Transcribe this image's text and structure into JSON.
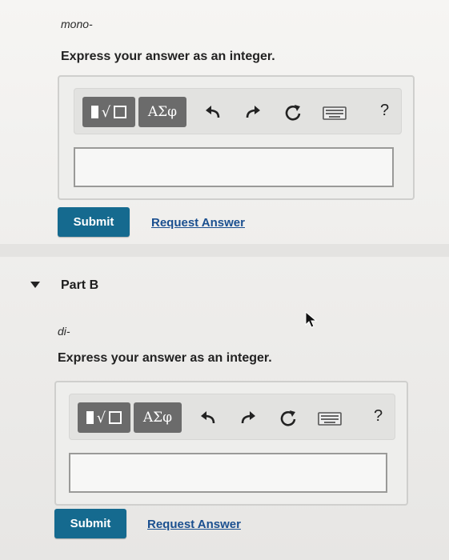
{
  "part_a": {
    "term": "mono-",
    "instruction": "Express your answer as an integer.",
    "toolbar": {
      "greek_label": "ΑΣφ",
      "help_label": "?"
    },
    "input_value": "",
    "submit_label": "Submit",
    "request_label": "Request Answer"
  },
  "part_b": {
    "title": "Part B",
    "term": "di-",
    "instruction": "Express your answer as an integer.",
    "toolbar": {
      "greek_label": "ΑΣφ",
      "help_label": "?"
    },
    "input_value": "",
    "submit_label": "Submit",
    "request_label": "Request Answer"
  },
  "colors": {
    "submit_bg": "#156a8f",
    "link": "#1a4f8f",
    "toolbar_button": "#6b6b6b"
  },
  "icons": [
    "template-icon",
    "undo-icon",
    "redo-icon",
    "reset-icon",
    "keyboard-icon",
    "help-icon",
    "caret-down-icon",
    "mouse-cursor-icon"
  ]
}
